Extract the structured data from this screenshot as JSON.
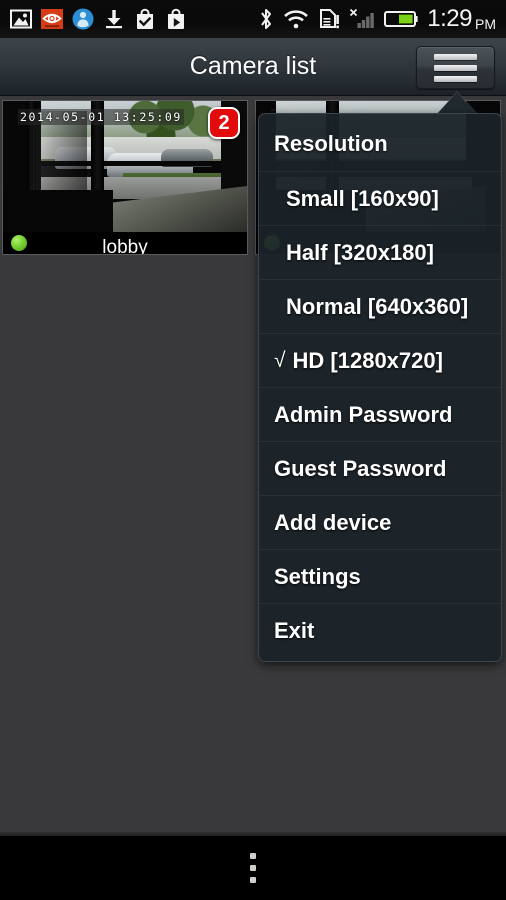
{
  "status_bar": {
    "icons_left": [
      {
        "name": "gallery-icon",
        "label": "Gallery"
      },
      {
        "name": "eye-app-icon",
        "label": "Eye app"
      },
      {
        "name": "contacts-sync-icon",
        "label": "Contacts sync"
      },
      {
        "name": "download-icon",
        "label": "Download complete"
      },
      {
        "name": "play-store-update-icon",
        "label": "Play Store update"
      },
      {
        "name": "play-store-icon",
        "label": "Play Store"
      }
    ],
    "icons_right": [
      {
        "name": "bluetooth-icon",
        "label": "Bluetooth"
      },
      {
        "name": "wifi-icon",
        "label": "Wi-Fi"
      },
      {
        "name": "sd-card-alert-icon",
        "label": "SD card alert"
      },
      {
        "name": "signal-no-service-icon",
        "label": "Mobile signal no service"
      },
      {
        "name": "battery-icon",
        "label": "Battery"
      }
    ],
    "clock": {
      "time": "1:29",
      "ampm": "PM"
    }
  },
  "title_bar": {
    "title": "Camera list",
    "menu_button_name": "hamburger-menu-button"
  },
  "cameras": [
    {
      "name": "lobby",
      "timestamp": "2014-05-01 13:25:09",
      "badge": "2",
      "online": true
    },
    {
      "name": "",
      "timestamp": "",
      "badge": "",
      "online": true
    }
  ],
  "dropdown_menu": {
    "items": [
      {
        "label": "Resolution",
        "indent": 0,
        "checked": false,
        "name": "menu-item-resolution"
      },
      {
        "label": "Small [160x90]",
        "indent": 1,
        "checked": false,
        "name": "menu-item-small"
      },
      {
        "label": "Half [320x180]",
        "indent": 1,
        "checked": false,
        "name": "menu-item-half"
      },
      {
        "label": "Normal [640x360]",
        "indent": 1,
        "checked": false,
        "name": "menu-item-normal"
      },
      {
        "label": "HD [1280x720]",
        "indent": 0,
        "checked": true,
        "name": "menu-item-hd"
      },
      {
        "label": "Admin Password",
        "indent": 0,
        "checked": false,
        "name": "menu-item-admin-password"
      },
      {
        "label": "Guest Password",
        "indent": 0,
        "checked": false,
        "name": "menu-item-guest-password"
      },
      {
        "label": "Add device",
        "indent": 0,
        "checked": false,
        "name": "menu-item-add-device"
      },
      {
        "label": "Settings",
        "indent": 0,
        "checked": false,
        "name": "menu-item-settings"
      },
      {
        "label": "Exit",
        "indent": 0,
        "checked": false,
        "name": "menu-item-exit"
      }
    ],
    "check_glyph": "√"
  },
  "nav_bar": {
    "overflow_name": "overflow-menu-button"
  },
  "colors": {
    "badge_red": "#e20a0a",
    "online_green": "#76d134",
    "content_background": "#38383a",
    "title_bar_top": "#3d454b",
    "menu_background": "#1b2328",
    "text_white": "#ffffff"
  }
}
